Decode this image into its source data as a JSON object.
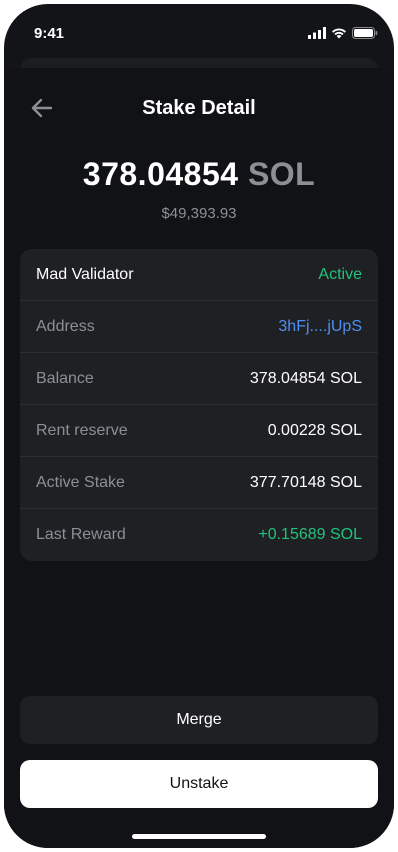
{
  "status_bar": {
    "time": "9:41"
  },
  "header": {
    "title": "Stake Detail"
  },
  "summary": {
    "amount": "378.04854",
    "unit": "SOL",
    "fiat": "$49,393.93"
  },
  "details": {
    "validator": {
      "name": "Mad Validator",
      "status": "Active"
    },
    "rows": [
      {
        "label": "Address",
        "value": "3hFj....jUpS"
      },
      {
        "label": "Balance",
        "value": "378.04854 SOL"
      },
      {
        "label": "Rent reserve",
        "value": "0.00228 SOL"
      },
      {
        "label": "Active Stake",
        "value": "377.70148 SOL"
      },
      {
        "label": "Last Reward",
        "value": "+0.15689 SOL"
      }
    ]
  },
  "actions": {
    "merge_label": "Merge",
    "unstake_label": "Unstake"
  },
  "colors": {
    "accent_green": "#22c27a",
    "accent_blue": "#4d8ff2",
    "background": "#111216"
  }
}
